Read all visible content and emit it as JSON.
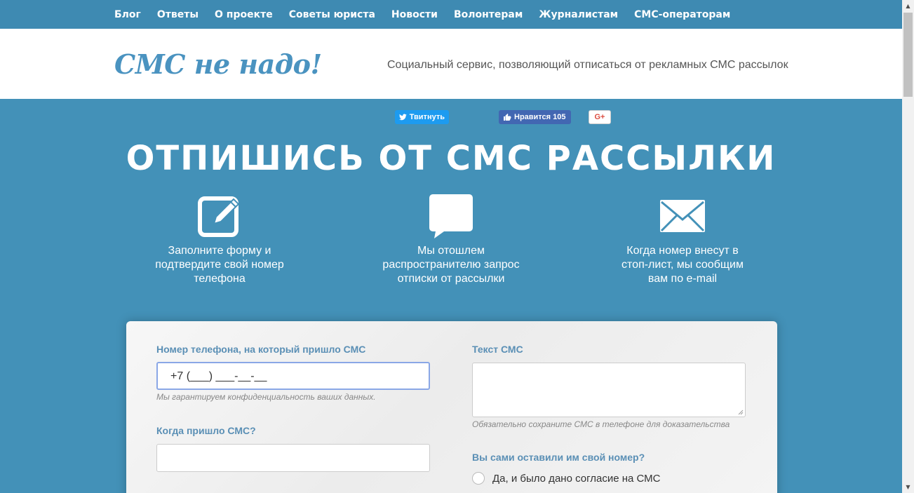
{
  "nav": {
    "items": [
      "Блог",
      "Ответы",
      "О проекте",
      "Советы юриста",
      "Новости",
      "Волонтерам",
      "Журналистам",
      "СМС-операторам"
    ]
  },
  "header": {
    "logo": "СМС не надо!",
    "tagline": "Социальный сервис, позволяющий отписаться от рекламных СМС рассылок"
  },
  "social": {
    "tweet_label": "Твитнуть",
    "like_label": "Нравится 105",
    "gplus_label": "G+"
  },
  "hero": {
    "title": "ОТПИШИСЬ ОТ СМС РАССЫЛКИ",
    "steps": [
      {
        "icon": "edit-icon",
        "text_lines": [
          "Заполните форму и",
          "подтвердите свой номер",
          "телефона"
        ]
      },
      {
        "icon": "speech-bubble-icon",
        "text_lines": [
          "Мы отошлем",
          "распространителю запрос",
          "отписки от рассылки"
        ]
      },
      {
        "icon": "envelope-icon",
        "text_lines": [
          "Когда номер внесут в",
          "стоп-лист, мы сообщим",
          "вам по e-mail"
        ]
      }
    ]
  },
  "form": {
    "phone_label": "Номер телефона, на который пришло СМС",
    "phone_value": "+7 (___) ___-__-__",
    "phone_hint": "Мы гарантируем конфиденциальность ваших данных.",
    "when_label": "Когда пришло СМС?",
    "when_value": "",
    "sms_text_label": "Текст СМС",
    "sms_text_value": "",
    "sms_text_hint": "Обязательно сохраните СМС в телефоне для доказательства",
    "consent_question": "Вы сами оставили им свой номер?",
    "consent_options": [
      "Да, и было дано согласие на СМС"
    ]
  },
  "colors": {
    "nav_bg": "#3e8ab2",
    "hero_bg": "#4391b8",
    "label": "#5a8fb5",
    "twitter": "#1d9bf0",
    "facebook": "#4267b2",
    "gplus": "#dc4e41"
  }
}
